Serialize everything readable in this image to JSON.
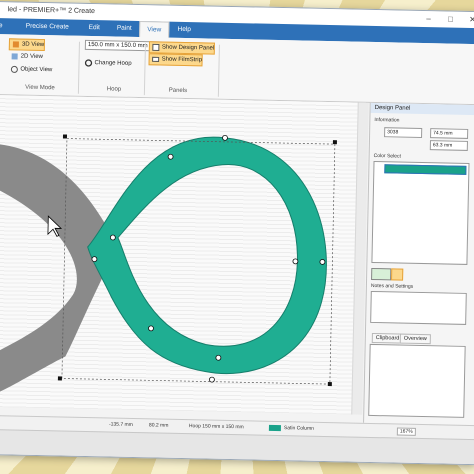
{
  "window": {
    "title": "led - PREMIER+™ 2 Create",
    "controls": [
      "–",
      "□",
      "✕"
    ]
  },
  "ribbon_tabs": [
    "ile",
    "Precise Create",
    "Edit",
    "Paint",
    "View",
    "Help"
  ],
  "active_tab": "View",
  "ribbon": {
    "view_mode": {
      "items": [
        "3D View",
        "2D View",
        "Object View"
      ],
      "selected": "3D View",
      "group_label": "View Mode"
    },
    "hoop": {
      "hoop_size": "150.0 mm x 150.0 mm",
      "change_hoop": "Change Hoop",
      "group_label": "Hoop"
    },
    "panels": {
      "items": [
        "Show Design Panel",
        "Show FilmStrip"
      ],
      "group_label": "Panels"
    }
  },
  "design_panel": {
    "title": "Design Panel",
    "information_label": "Information",
    "count_value": "3038",
    "width_value": "74.5 mm",
    "height_value": "63.3 mm",
    "color_select_label": "Color Select",
    "selected_color": "#1aa28a",
    "notes_label": "Notes and Settings",
    "bottom_tabs": [
      "Clipboard",
      "Overview"
    ]
  },
  "canvas": {
    "fill_color": "#1fae92",
    "gray_color": "#8a8a8a",
    "shape": "figure-eight satin column"
  },
  "statusbar": {
    "x_coord": "-135.7 mm",
    "y_coord": "80.2 mm",
    "hoop": "Hoop 150 mm x 150 mm",
    "stitch_type": "Satin Column",
    "zoom": "167%"
  }
}
